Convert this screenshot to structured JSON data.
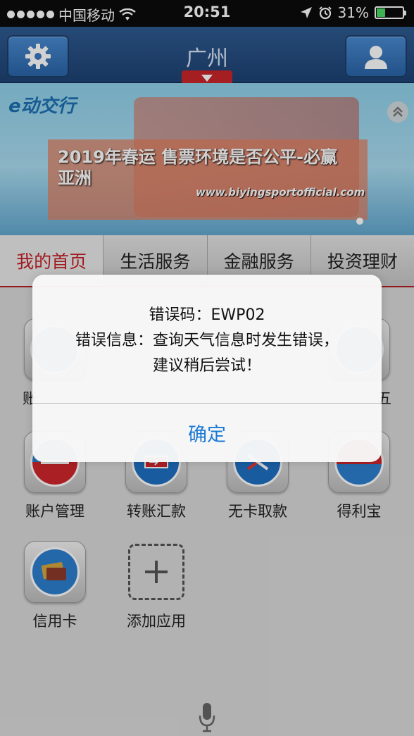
{
  "status_bar": {
    "carrier": "中国移动",
    "time": "20:51",
    "battery_percent": "31%",
    "battery_level": 0.31,
    "icons": [
      "signal-dots-icon",
      "wifi-icon",
      "location-arrow-icon",
      "alarm-icon",
      "battery-icon"
    ]
  },
  "header": {
    "city": "广州",
    "left_icon": "gear-icon",
    "right_icon": "user-icon",
    "dropdown_icon": "triangle-down-icon"
  },
  "banner": {
    "logo": "e动交行",
    "title": "2019年春运 售票环境是否公平-必赢亚洲",
    "url": "www.biyingsportofficial.com",
    "collapse_icon": "double-chevron-up-icon"
  },
  "tabs": [
    {
      "label": "我的首页",
      "active": true
    },
    {
      "label": "生活服务",
      "active": false
    },
    {
      "label": "金融服务",
      "active": false
    },
    {
      "label": "投资理财",
      "active": false
    }
  ],
  "apps": [
    {
      "label": "账",
      "icon": "account-icon"
    },
    {
      "label": "五",
      "icon": "friday-icon"
    },
    {
      "label": "账户管理",
      "icon": "account-management-icon"
    },
    {
      "label": "转账汇款",
      "icon": "transfer-icon"
    },
    {
      "label": "无卡取款",
      "icon": "cardless-withdrawal-icon"
    },
    {
      "label": "得利宝",
      "icon": "delibao-icon"
    },
    {
      "label": "信用卡",
      "icon": "credit-card-icon"
    },
    {
      "label": "添加应用",
      "icon": "plus-icon"
    }
  ],
  "alert": {
    "line1": "错误码：EWP02",
    "line2": "错误信息：查询天气信息时发生错误，",
    "line3": "建议稍后尝试！",
    "button": "确定"
  },
  "colors": {
    "header_blue": "#2a5590",
    "accent_red": "#c42027",
    "alert_button_blue": "#1b79d6"
  },
  "bottom_icon": "microphone-icon"
}
